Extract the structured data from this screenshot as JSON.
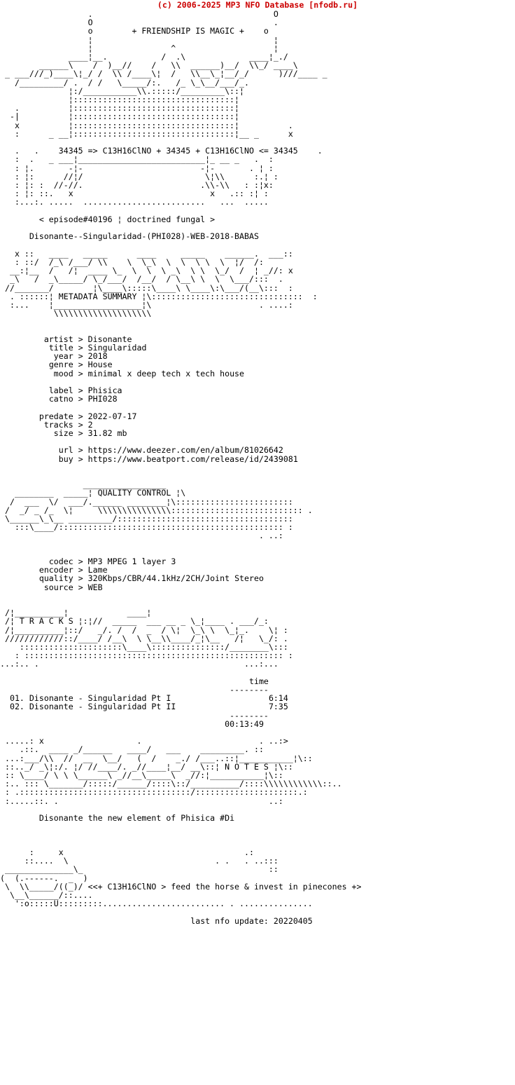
{
  "header": {
    "copyright": "(c) 2006-2025 MP3 NFO Database [nfodb.ru]",
    "color": "#cc0000"
  },
  "banner": {
    "tagline": "+ FRIENDSHIP IS MAGIC +",
    "formula_line": "34345 => C13H16ClNO + 34345 + C13H16ClNO <= 34345",
    "episode_line": "< episode#40196 ¦ doctrined fungal >",
    "release_name": "Disonante--Singularidad-(PHI028)-WEB-2018-BABAS"
  },
  "sections": {
    "metadata_title": "METADATA SUMMARY",
    "quality_title": "QUALITY CONTROL",
    "tracks_title": "T R A C K S",
    "notes_title": "N O T E S"
  },
  "metadata": {
    "group1": [
      {
        "key": "artist",
        "sep": ">",
        "value": "Disonante"
      },
      {
        "key": "title",
        "sep": ">",
        "value": "Singularidad"
      },
      {
        "key": "year",
        "sep": ">",
        "value": "2018"
      },
      {
        "key": "genre",
        "sep": ">",
        "value": "House"
      },
      {
        "key": "mood",
        "sep": ">",
        "value": "minimal x deep tech x tech house"
      }
    ],
    "group2": [
      {
        "key": "label",
        "sep": ">",
        "value": "Phisica"
      },
      {
        "key": "catno",
        "sep": ">",
        "value": "PHI028"
      }
    ],
    "group3": [
      {
        "key": "predate",
        "sep": ">",
        "value": "2022-07-17"
      },
      {
        "key": "tracks",
        "sep": ">",
        "value": "2"
      },
      {
        "key": "size",
        "sep": ">",
        "value": "31.82 mb"
      }
    ],
    "group4": [
      {
        "key": "url",
        "sep": ">",
        "value": "https://www.deezer.com/en/album/81026642"
      },
      {
        "key": "buy",
        "sep": ">",
        "value": "https://www.beatport.com/release/id/2439081"
      }
    ]
  },
  "quality": [
    {
      "key": "codec",
      "sep": ">",
      "value": "MP3 MPEG 1 layer 3"
    },
    {
      "key": "encoder",
      "sep": ">",
      "value": "Lame"
    },
    {
      "key": "quality",
      "sep": ">",
      "value": "320Kbps/CBR/44.1kHz/2CH/Joint Stereo"
    },
    {
      "key": "source",
      "sep": ">",
      "value": "WEB"
    }
  ],
  "tracklist": {
    "time_header": "time",
    "rule": "--------",
    "items": [
      {
        "num": "01.",
        "title": "Disonante - Singularidad Pt I",
        "time": "6:14"
      },
      {
        "num": "02.",
        "title": "Disonante - Singularidad Pt II",
        "time": "7:35"
      }
    ],
    "total": "00:13:49"
  },
  "notes": {
    "text": "Disonante the new element of Phisica #Di"
  },
  "footer": {
    "slogan": "<<+ C13H16ClNO > feed the horse & invest in pinecones +>",
    "last_update": "last nfo update: 20220405"
  },
  "ascii": {
    "top_logo": "                   .                                     O\n                   O                                     .\n                   o             + FRIENDSHIP IS MAGIC + o\n                   !                                     !\n         _         |                 ^                   |\n  _ ___ /// \\\\  ___ |___ )__ //  ^  \\\\  ___ )__ / \\\\ ___  |__ /   _  _\n  ___///_)___\\\\|      )__//  / \\\\  \\\\__)  / \\\\   \\\\_|___)  //___ _\n   /_______ /  .  / .  \\\\______/:  /   \\\\ /_  \\\\____ /  ___\n              |:/__________\\\\.::::/_________\\\\::|\n              |:::::::::::::::::::::::::::::::|\n  .           |:::::::::::::::::::::::::::::::|\n  |           |:::::::::::::::::::::::::::::::|            .\n  x           |:::::::::::::::::::::::::::::::|            .\n  :        _ _|:::::::::::::::::::::::::::::::|__ _        x\n\n  .   .    34345 => C13H16ClNO + 34345 + C13H16ClNO <= 34345     .\n  :\n  : | .  _ _|_______________________________|_ _  . | :\n  : |:    -|-                             -|-      :|:\n  : |:   //-//.                           .\\\\-\\\\     :|:\n  : |:  :   x                               x    :  :|:\n  : |: ::.                                     .:: :|:\n  :...:.......................................... ....",
    "meta_banner": "   x ::    ___   _____      ____     ______    ______.  ___::\n   : ::/  /_\\\\ /___/ \\\\\\\\   \\\\  \\\\  \\\\  \\\\  \\\\ \\\\  \\\\  |/  /:\n  __:|__  /   /|  ____ \\\\_ \\\\  \\\\  \\\\ _ \\\\  \\\\ \\\\ _/ /  | _//: x\n  _\\\\   /  _\\\\_____/ \\\\_/___/  /__/  / \\\\  \\\\ \\\\  \\\\  \\\\___/:::  .\n //_______/           |\\\\____\\\\:::::\\\\____\\\\ \\\\___\\\\:\\\\___/(__\\\\:::\n  . ::::::| METADATA SUMMARY |\\\\::::::::::::::::::::::::::::::::  :\n  :...    |__________________|\\\\                          . ....:\n           \\\\\\\\\\\\\\\\\\\\\\\\\\\\\\\\\\\\\\\\\\\\\\\\\\\\\\\\\\\\\\\\\\\\\\\\\\\\",
    "qc_banner": "                 ________________\n   _________ ______|                |\\\\\n  /  ___   \\\\/  ____/| QUALITY CONTROL |\\\\\n /  /_ _  /_   \\\\|  _____  _________|\\\\::::::::::::::::::::::::::::\n \\\\______\\\\/\\\\___\\\\  __________/\\\\\\\\\\\\\\\\\\\\\\\\\\\\\\\\\\\\:::::::::::::::::::::::::::::  .\n    :::\\\\_____/:::::::::::::::::::::::::::::::::::::::::::::::::::  :\n                                                        . ..:",
    "tracks_banner": " /|__________|\n /| T R A C K S |:|// ______  _____  ___ .__\\\\  |____  . ____/_:\n /|____________|::/   _/. /  /  _  / \\\\|   \\\\ \\\\  \\\\_|_.    \\\\| :\n ////////////::/____/ /___\\\\  \\\\ \\\\__\\\\\\\\_____/_|\\\\__   /|   \\\\_/: .\n    ::::::::::::::::::::::::\\\\_____\\\\::::::::::::::::/________\\\\:::\n  : :::::::::::::::::::::::::::::::::::::::::::::::::::::::::::  :\n...:.. .                                               ...:...",
    "notes_banner": "  .....: x                    .                           . ..:>\n     .::.  ____ _/______    ____/    ___    _________. ::\n  ...:___/\\\\\\\\  //  __  \\\\__/   (  /    _./ /___..|        |\\\\::\n ::..\\\\_/ _\\\\|:/. |/ //____/. _//____|__/ __\\\\::| N O T E S |\\\\::\n :: \\\\____/ \\\\ \\\\ \\\\______\\\\ _//__\\\\_____\\\\  _//.:|___________|\\\\::\n :.. ::: \\\\_______/:::::/______/::::\\\\::/__________/::::\\\\\\\\\\\\\\\\\\\\\\\\\\\\::..\n : .:::::::::::::::::::::::::::::::::::::/::::::::::::::::::::::.:\n :.....::. .                                              ..:",
    "horse": "       :     x                                      .:\n      ::....  \\\\                               . .   . ..:::\n  ______________\\\\_                                      ::\n (  (.------.  _  )\n  \\\\  \\\\_____/((_)/ \n   \\\\__\\\\______/::....\n    ':o:::::U:::::::::.......................... . ..............."
  }
}
